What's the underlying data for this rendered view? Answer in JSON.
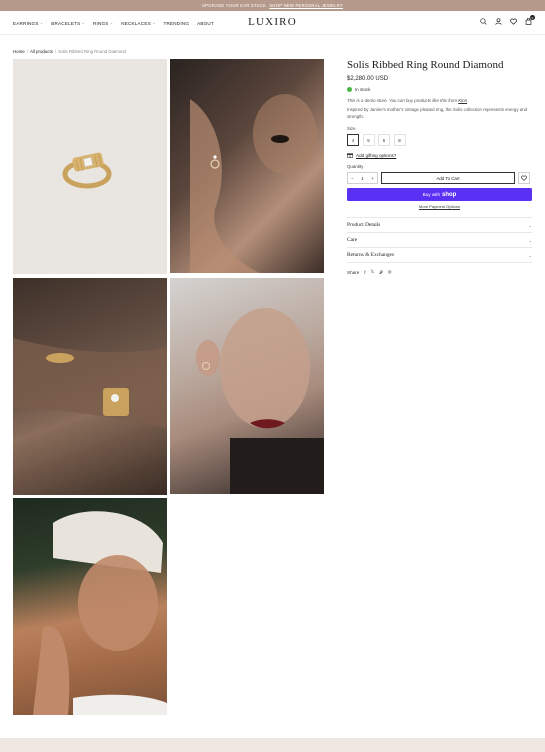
{
  "announcement": {
    "text": "UPGRADE YOUR EAR STACK.",
    "link": "SHOP NEW PERSONAL JEWELRY"
  },
  "nav": {
    "items": [
      {
        "label": "EARRINGS",
        "dropdown": true
      },
      {
        "label": "BRACELETS",
        "dropdown": true
      },
      {
        "label": "RINGS",
        "dropdown": true
      },
      {
        "label": "NECKLACES",
        "dropdown": true
      },
      {
        "label": "TRENDING",
        "dropdown": false
      },
      {
        "label": "ABOUT",
        "dropdown": false
      }
    ]
  },
  "logo": "LUXIRO",
  "header": {
    "cart_count": "0"
  },
  "breadcrumb": {
    "home": "Home",
    "all": "All products",
    "current": "Solis Ribbed Ring Round Diamond"
  },
  "product": {
    "title": "Solis Ribbed Ring Round Diamond",
    "price": "$2,280.00 USD",
    "stock": "In stock",
    "demo_text": "This is a demo store. You can buy products like this from",
    "demo_link": "Kinn",
    "description": "Inspired by Janine's mother's vintage pleated ring, the Solis collection represents energy and strength.",
    "size_label": "Size",
    "sizes": [
      "4",
      "5",
      "6",
      "8"
    ],
    "selected_size": "4",
    "gift_label": "Add gifting options?",
    "quantity_label": "Quantity",
    "quantity": "1",
    "add_to_cart": "Add To Cart",
    "buy_with": "Buy with",
    "shop_brand": "shop",
    "more_payment": "More Payment Options",
    "accordions": [
      "Product Details",
      "Care",
      "Returns & Exchanges"
    ],
    "share_label": "Share"
  },
  "colors": {
    "announcement_bg": "#b59a8c",
    "shop_pay": "#5a31f4",
    "in_stock": "#4bb543",
    "footer_band": "#ede6e1"
  }
}
